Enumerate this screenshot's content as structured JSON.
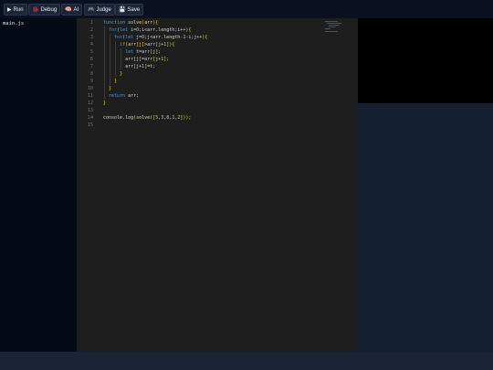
{
  "toolbar": {
    "buttons": [
      {
        "id": "run",
        "icon": "▶",
        "label": "Run"
      },
      {
        "id": "debug",
        "icon": "🐞",
        "label": "Debug"
      },
      {
        "id": "ai",
        "icon": "🧠",
        "label": "AI"
      },
      {
        "id": "judge",
        "icon": "🎮",
        "label": "Judge"
      },
      {
        "id": "save",
        "icon": "💾",
        "label": "Save"
      }
    ]
  },
  "sidebar": {
    "files": [
      {
        "name": "main.js"
      }
    ]
  },
  "editor": {
    "line_numbers": [
      "1",
      "2",
      "3",
      "4",
      "5",
      "6",
      "7",
      "8",
      "9",
      "10",
      "11",
      "12",
      "13",
      "14",
      "15"
    ],
    "lines": [
      "function solve(arr){",
      "  for(let i=0;i<arr.length;i++){",
      "    for(let j=0;j<arr.length-1-i;j++){",
      "      if(arr[j]>arr[j+1]){",
      "        let t=arr[j];",
      "        arr[j]=arr[j+1];",
      "        arr[j+1]=t;",
      "      }",
      "    }",
      "  }",
      "  return arr;",
      "}",
      "",
      "console.log(solve([5,3,8,1,2]));",
      ""
    ]
  },
  "colors": {
    "background": "#0b1222",
    "editor_bg": "#1e1e1e",
    "keyword": "#569cd6",
    "function": "#dcdcaa",
    "number": "#b5cea8",
    "bracket": "#ffd700",
    "preview_bg": "#000000",
    "panel_bg": "#162033"
  }
}
